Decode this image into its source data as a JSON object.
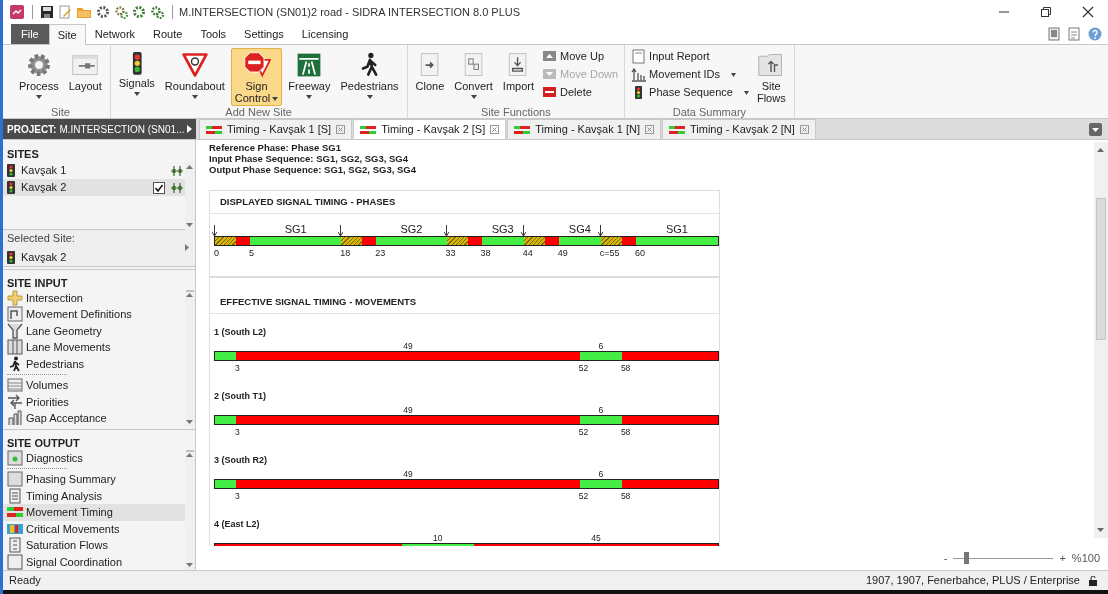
{
  "window": {
    "title": "M.INTERSECTION (SN01)2 road - SIDRA INTERSECTION 8.0 PLUS"
  },
  "ribbon_tabs": [
    {
      "label": "File",
      "kind": "file",
      "selected": false
    },
    {
      "label": "Site",
      "kind": "tab",
      "selected": true
    },
    {
      "label": "Network",
      "kind": "tab",
      "selected": false
    },
    {
      "label": "Route",
      "kind": "tab",
      "selected": false
    },
    {
      "label": "Tools",
      "kind": "tab",
      "selected": false
    },
    {
      "label": "Settings",
      "kind": "tab",
      "selected": false
    },
    {
      "label": "Licensing",
      "kind": "tab",
      "selected": false
    }
  ],
  "ribbon_groups": [
    {
      "label": "Site",
      "items": [
        {
          "kind": "large",
          "label": "Process",
          "dropdown": true,
          "selected": false,
          "disabled": false
        },
        {
          "kind": "large",
          "label": "Layout",
          "dropdown": false,
          "selected": false,
          "disabled": false
        }
      ]
    },
    {
      "label": "Add New Site",
      "items": [
        {
          "kind": "large",
          "label": "Signals",
          "dropdown": true,
          "selected": false,
          "disabled": false
        },
        {
          "kind": "large",
          "label": "Roundabout",
          "dropdown": true,
          "selected": false,
          "disabled": false
        },
        {
          "kind": "large",
          "label": "Sign\nControl",
          "dropdown": true,
          "selected": true,
          "disabled": false
        },
        {
          "kind": "large",
          "label": "Freeway",
          "dropdown": true,
          "selected": false,
          "disabled": false
        },
        {
          "kind": "large",
          "label": "Pedestrians",
          "dropdown": true,
          "selected": false,
          "disabled": false
        }
      ]
    },
    {
      "label": "Site Functions",
      "items": [
        {
          "kind": "large",
          "label": "Clone",
          "dropdown": false,
          "selected": false,
          "disabled": false
        },
        {
          "kind": "large",
          "label": "Convert",
          "dropdown": true,
          "selected": false,
          "disabled": false
        },
        {
          "kind": "large",
          "label": "Import",
          "dropdown": false,
          "selected": false,
          "disabled": false
        },
        {
          "kind": "small",
          "label": "Move Up",
          "dropdown": false,
          "selected": false,
          "disabled": false
        },
        {
          "kind": "small",
          "label": "Move Down",
          "dropdown": false,
          "selected": false,
          "disabled": true
        },
        {
          "kind": "small",
          "label": "Delete",
          "dropdown": false,
          "selected": false,
          "disabled": false
        }
      ]
    },
    {
      "label": "Data Summary",
      "items": [
        {
          "kind": "small",
          "label": "Input Report",
          "dropdown": false,
          "selected": false,
          "disabled": false
        },
        {
          "kind": "small",
          "label": "Movement IDs",
          "dropdown": true,
          "selected": false,
          "disabled": false
        },
        {
          "kind": "small",
          "label": "Phase Sequence",
          "dropdown": true,
          "selected": false,
          "disabled": false
        },
        {
          "kind": "large",
          "label": "Site\nFlows",
          "dropdown": false,
          "selected": false,
          "disabled": false
        }
      ]
    }
  ],
  "project": {
    "label": "PROJECT:",
    "name": "M.INTERSECTION (SN01..."
  },
  "document_tabs": [
    {
      "label": "Timing - Kavşak 1 [S]",
      "selected": false
    },
    {
      "label": "Timing - Kavşak 2 [S]",
      "selected": true
    },
    {
      "label": "Timing - Kavşak 1 [N]",
      "selected": false
    },
    {
      "label": "Timing - Kavşak 2 [N]",
      "selected": false
    }
  ],
  "sites": {
    "title": "SITES",
    "items": [
      {
        "label": "Kavşak 1",
        "checked": false,
        "selected": false
      },
      {
        "label": "Kavşak 2",
        "checked": true,
        "selected": true
      }
    ]
  },
  "selected_site": {
    "title": "Selected Site:",
    "value": "Kavşak 2"
  },
  "site_input": {
    "title": "SITE INPUT",
    "groups": [
      [
        {
          "label": "Intersection",
          "selected": false
        },
        {
          "label": "Movement Definitions",
          "selected": false
        },
        {
          "label": "Lane Geometry",
          "selected": false
        },
        {
          "label": "Lane Movements",
          "selected": false
        },
        {
          "label": "Pedestrians",
          "selected": false
        }
      ],
      [
        {
          "label": "Volumes",
          "selected": false
        },
        {
          "label": "Priorities",
          "selected": false
        },
        {
          "label": "Gap Acceptance",
          "selected": false
        }
      ]
    ]
  },
  "site_output": {
    "title": "SITE OUTPUT",
    "groups": [
      [
        {
          "label": "Diagnostics",
          "selected": false
        }
      ],
      [
        {
          "label": "Phasing Summary",
          "selected": false
        },
        {
          "label": "Timing Analysis",
          "selected": false
        },
        {
          "label": "Movement Timing",
          "selected": true
        },
        {
          "label": "Critical Movements",
          "selected": false
        },
        {
          "label": "Saturation Flows",
          "selected": false
        },
        {
          "label": "Signal Coordination",
          "selected": false
        }
      ]
    ]
  },
  "report": {
    "lines": [
      "Reference Phase: Phase SG1",
      "Input Phase Sequence: SG1, SG2, SG3, SG4",
      "Output Phase Sequence: SG1, SG2, SG3, SG4"
    ],
    "phases_panel": {
      "title": "DISPLAYED SIGNAL TIMING - PHASES",
      "segments": [
        {
          "kind": "intergreen",
          "start_label": "0"
        },
        {
          "kind": "red"
        },
        {
          "kind": "green",
          "start_label": "5",
          "top_label": "SG1"
        },
        {
          "kind": "intergreen",
          "start_label": "18"
        },
        {
          "kind": "red"
        },
        {
          "kind": "green",
          "start_label": "23",
          "top_label": "SG2"
        },
        {
          "kind": "intergreen",
          "start_label": "33"
        },
        {
          "kind": "red"
        },
        {
          "kind": "green",
          "start_label": "38",
          "top_label": "SG3"
        },
        {
          "kind": "intergreen",
          "start_label": "44"
        },
        {
          "kind": "red"
        },
        {
          "kind": "green",
          "start_label": "49",
          "top_label": "SG4"
        },
        {
          "kind": "intergreen",
          "start_label": "c=55"
        },
        {
          "kind": "red"
        },
        {
          "kind": "green",
          "start_label": "60",
          "top_label": "SG1"
        }
      ]
    },
    "movements_panel": {
      "title": "EFFECTIVE SIGNAL TIMING - MOVEMENTS",
      "movements": [
        {
          "name": "1 (South L2)",
          "segments": [
            {
              "kind": "green"
            },
            {
              "kind": "red",
              "start_label": "3",
              "top_label": "49"
            },
            {
              "kind": "green",
              "start_label": "52",
              "top_label": "6"
            },
            {
              "kind": "red",
              "start_label": "58"
            }
          ]
        },
        {
          "name": "2 (South T1)",
          "segments": [
            {
              "kind": "green"
            },
            {
              "kind": "red",
              "start_label": "3",
              "top_label": "49"
            },
            {
              "kind": "green",
              "start_label": "52",
              "top_label": "6"
            },
            {
              "kind": "red",
              "start_label": "58"
            }
          ]
        },
        {
          "name": "3 (South R2)",
          "segments": [
            {
              "kind": "green"
            },
            {
              "kind": "red",
              "start_label": "3",
              "top_label": "49"
            },
            {
              "kind": "green",
              "start_label": "52",
              "top_label": "6"
            },
            {
              "kind": "red",
              "start_label": "58"
            }
          ]
        },
        {
          "name": "4 (East L2)",
          "segments": [
            {
              "kind": "red"
            },
            {
              "kind": "green",
              "top_label": "10"
            },
            {
              "kind": "red",
              "top_label": "45"
            }
          ]
        }
      ]
    }
  },
  "zoom": {
    "minus": "-",
    "plus": "+",
    "value": "%100",
    "level": 0.13
  },
  "status_bar": {
    "left": "Ready",
    "right": "1907, 1907, Fenerbahce, PLUS / Enterprise"
  }
}
